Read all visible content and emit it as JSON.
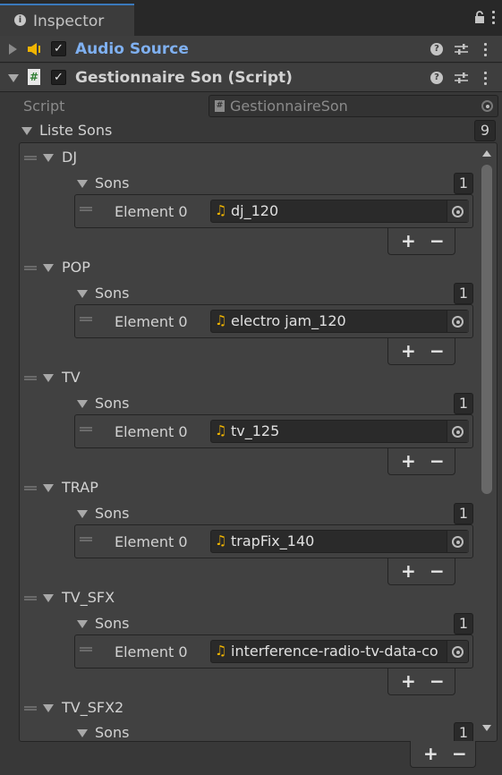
{
  "tab": {
    "title": "Inspector"
  },
  "audio_source": {
    "title": "Audio Source",
    "enabled": true
  },
  "script_component": {
    "title": "Gestionnaire Son (Script)",
    "enabled": true,
    "script_label": "Script",
    "script_value": "GestionnaireSon"
  },
  "liste_sons": {
    "label": "Liste Sons",
    "count": "9"
  },
  "groups": [
    {
      "name": "DJ",
      "sons_label": "Sons",
      "count": "1",
      "element_label": "Element 0",
      "clip": "dj_120"
    },
    {
      "name": "POP",
      "sons_label": "Sons",
      "count": "1",
      "element_label": "Element 0",
      "clip": "electro jam_120"
    },
    {
      "name": "TV",
      "sons_label": "Sons",
      "count": "1",
      "element_label": "Element 0",
      "clip": "tv_125"
    },
    {
      "name": "TRAP",
      "sons_label": "Sons",
      "count": "1",
      "element_label": "Element 0",
      "clip": "trapFix_140"
    },
    {
      "name": "TV_SFX",
      "sons_label": "Sons",
      "count": "1",
      "element_label": "Element 0",
      "clip": "interference-radio-tv-data-co"
    },
    {
      "name": "TV_SFX2",
      "sons_label": "Sons",
      "count": "1"
    }
  ],
  "buttons": {
    "plus": "+",
    "minus": "−"
  },
  "colors": {
    "accent_blue": "#7fb0f0",
    "tab_highlight": "#3a79bb",
    "audio_icon": "#f0b400",
    "background": "#383838"
  },
  "icons": {
    "tab": "info-icon",
    "lock": "lock-icon",
    "menu": "kebab-menu-icon",
    "help": "help-icon",
    "presets": "presets-icon",
    "audio": "speaker-icon",
    "script": "script-hash-icon",
    "clip": "music-note-icon",
    "picker": "object-picker-icon"
  }
}
